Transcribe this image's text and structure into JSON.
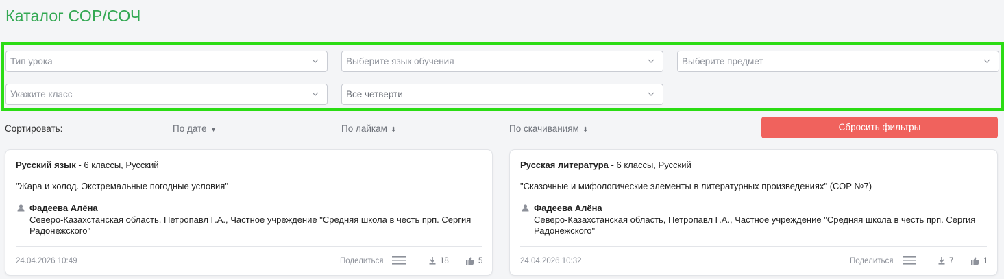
{
  "page": {
    "title": "Каталог СОР/СОЧ"
  },
  "filters": {
    "lesson_type": "Тип урока",
    "language": "Выберите язык обучения",
    "subject": "Выберите предмет",
    "grade": "Укажите класс",
    "quarter": "Все четверти"
  },
  "sort": {
    "label": "Сортировать:",
    "by_date": "По дате",
    "by_date_arrow": "▼",
    "by_likes": "По лайкам",
    "by_likes_arrow": "⬍",
    "by_downloads": "По скачиваниям",
    "by_downloads_arrow": "⬍",
    "reset": "Сбросить фильтры"
  },
  "cards": [
    {
      "subject": "Русский язык",
      "meta": " - 6 классы, Русский",
      "title": "\"Жара и холод. Экстремальные погодные условия\"",
      "author": "Фадеева Алёна",
      "org": "Северо-Казахстанская область, Петропавл Г.А., Частное учреждение \"Средняя школа в честь прп. Сергия Радонежского\"",
      "date": "24.04.2026 10:49",
      "share": "Поделиться",
      "downloads": "18",
      "likes": "5"
    },
    {
      "subject": "Русская литература",
      "meta": " - 6 классы, Русский",
      "title": "\"Сказочные и мифологические элементы в литературных произведениях\" (СОР №7)",
      "author": "Фадеева Алёна",
      "org": "Северо-Казахстанская область, Петропавл Г.А., Частное учреждение \"Средняя школа в честь прп. Сергия Радонежского\"",
      "date": "24.04.2026 10:32",
      "share": "Поделиться",
      "downloads": "7",
      "likes": "1"
    }
  ],
  "icons": {
    "chevron": "chevron-down-icon",
    "user": "user-icon",
    "menu": "menu-icon",
    "download": "download-icon",
    "like": "thumbs-up-icon"
  },
  "colors": {
    "title": "#33a853",
    "highlight_border": "#2bdc14",
    "reset_button": "#f0625d"
  }
}
